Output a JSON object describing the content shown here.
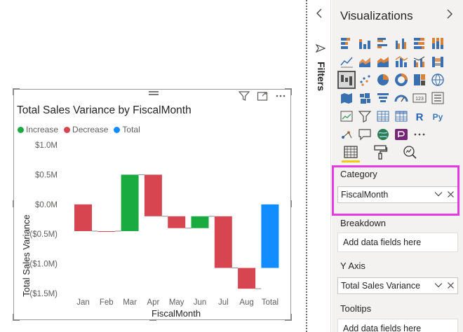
{
  "visual": {
    "title": "Total Sales Variance by FiscalMonth",
    "legend": [
      {
        "label": "Increase",
        "color": "#1aab40"
      },
      {
        "label": "Decrease",
        "color": "#d64550"
      },
      {
        "label": "Total",
        "color": "#118dff"
      }
    ],
    "header_icons": [
      "filter-icon",
      "focus-mode-icon",
      "more-options-icon"
    ]
  },
  "chart_data": {
    "type": "bar",
    "subtype": "waterfall",
    "title": "Total Sales Variance by FiscalMonth",
    "xlabel": "FiscalMonth",
    "ylabel": "Total Sales Variance",
    "categories": [
      "Jan",
      "Feb",
      "Mar",
      "Apr",
      "May",
      "Jun",
      "Jul",
      "Aug",
      "Total"
    ],
    "values": [
      -0.45,
      0.0,
      0.95,
      -0.7,
      -0.2,
      0.2,
      -0.87,
      -0.35,
      -1.07
    ],
    "kinds": [
      "decrease",
      "decrease",
      "increase",
      "decrease",
      "decrease",
      "increase",
      "decrease",
      "decrease",
      "total"
    ],
    "unit": "M",
    "ylim": [
      -1.5,
      1.0
    ],
    "yticks": [
      "$1.0M",
      "$0.5M",
      "$0.0M",
      "($0.5M)",
      "($1.0M)",
      "($1.5M)"
    ],
    "ytick_values": [
      1.0,
      0.5,
      0.0,
      -0.5,
      -1.0,
      -1.5
    ],
    "grid": false,
    "legend_position": "top-left",
    "colors": {
      "increase": "#1aab40",
      "decrease": "#d64550",
      "total": "#118dff"
    }
  },
  "filters": {
    "label": "Filters",
    "collapse_icon": "chevron-left-icon"
  },
  "visualizations": {
    "title": "Visualizations",
    "expand_icon": "chevron-right-icon",
    "icons": [
      "stacked-bar-chart-icon",
      "stacked-column-chart-icon",
      "clustered-bar-chart-icon",
      "clustered-column-chart-icon",
      "100-stacked-bar-chart-icon",
      "100-stacked-column-chart-icon",
      "line-chart-icon",
      "area-chart-icon",
      "stacked-area-chart-icon",
      "line-and-stacked-column-chart-icon",
      "line-and-clustered-column-chart-icon",
      "ribbon-chart-icon",
      "waterfall-chart-icon",
      "scatter-chart-icon",
      "pie-chart-icon",
      "donut-chart-icon",
      "treemap-icon",
      "map-icon",
      "filled-map-icon",
      "shape-map-icon",
      "funnel-icon",
      "gauge-icon",
      "card-icon",
      "multi-row-card-icon",
      "kpi-icon",
      "slicer-icon",
      "table-icon",
      "matrix-icon",
      "r-visual-icon",
      "python-visual-icon",
      "key-influencers-icon",
      "qa-icon",
      "arcgis-map-icon",
      "power-apps-icon",
      "more-visuals-icon"
    ],
    "tabs": [
      "fields-tab-icon",
      "format-tab-icon",
      "analytics-tab-icon"
    ],
    "wells": {
      "category": {
        "label": "Category",
        "value": "FiscalMonth"
      },
      "breakdown": {
        "label": "Breakdown",
        "placeholder": "Add data fields here"
      },
      "y_axis": {
        "label": "Y Axis",
        "value": "Total Sales Variance"
      },
      "tooltips": {
        "label": "Tooltips",
        "placeholder": "Add data fields here"
      }
    }
  }
}
